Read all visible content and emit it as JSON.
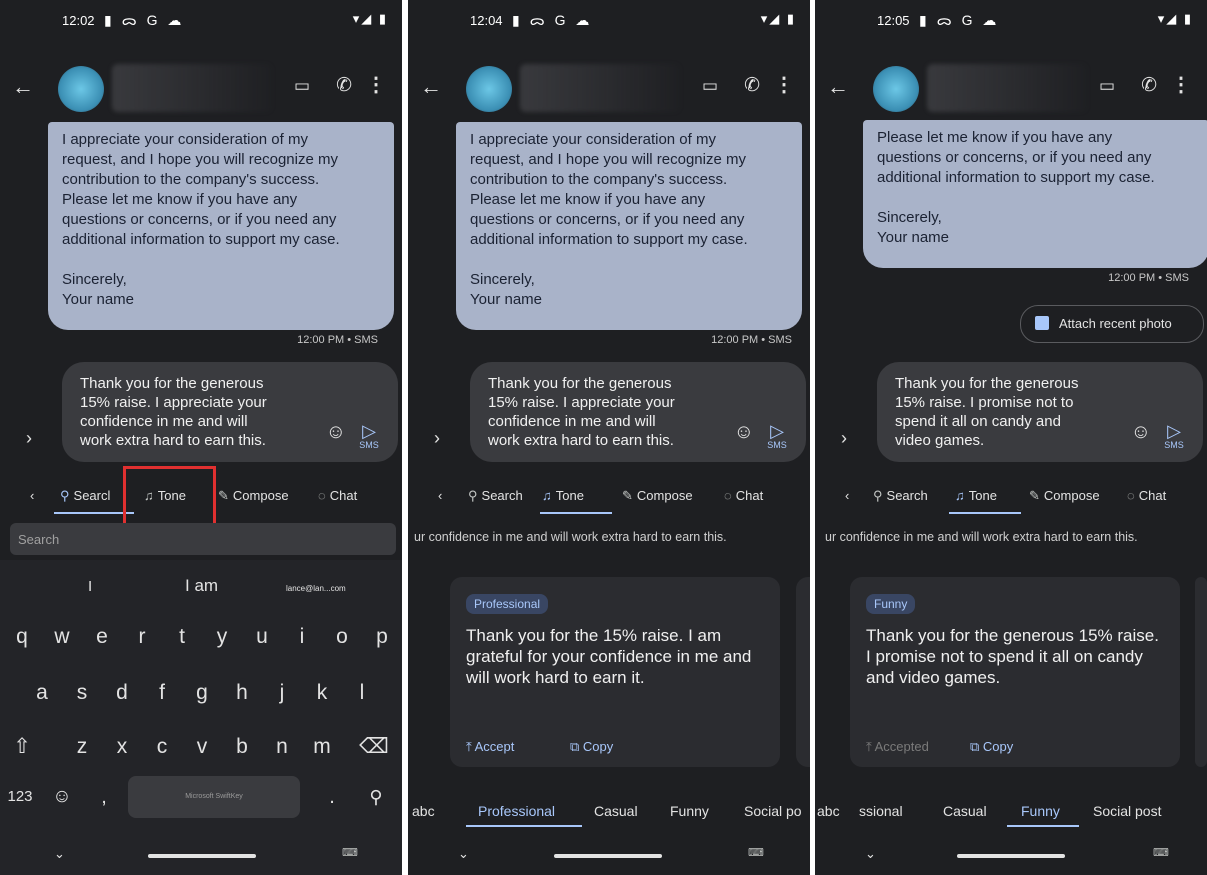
{
  "panels": [
    {
      "time": "12:02",
      "status_icons": "▮ ᯅ G ☁",
      "status_right": "▾◢ ▮",
      "bubble_lines": [
        "I appreciate your consideration of my",
        "request, and I hope you will recognize my",
        "contribution to the company's success.",
        "Please let me know if you have any",
        "questions or concerns, or if you need any",
        "additional information to support my case."
      ],
      "sign_off": [
        "Sincerely,",
        "Your name"
      ],
      "meta": "12:00 PM • SMS",
      "draft_lines": [
        "Thank you for the generous",
        "15% raise. I appreciate your",
        "confidence in me and will",
        "work extra hard to earn this."
      ],
      "send_label": "SMS",
      "toolbar": {
        "search": "Searcl",
        "tone": "Tone",
        "compose": "Compose",
        "chat": "Chat"
      },
      "search_placeholder": "Search",
      "suggestions": [
        "I",
        "I am",
        "lance@lan...com"
      ],
      "rows": [
        [
          "q",
          "w",
          "e",
          "r",
          "t",
          "y",
          "u",
          "i",
          "o",
          "p"
        ],
        [
          "a",
          "s",
          "d",
          "f",
          "g",
          "h",
          "j",
          "k",
          "l"
        ],
        [
          "z",
          "x",
          "c",
          "v",
          "b",
          "n",
          "m"
        ]
      ],
      "key_123": "123",
      "spacebar_label": "Microsoft SwiftKey"
    },
    {
      "time": "12:04",
      "status_icons": "▮ ᯅ G ☁",
      "status_right": "▾◢ ▮",
      "bubble_lines": [
        "I appreciate your consideration of my",
        "request, and I hope you will recognize my",
        "contribution to the company's success.",
        "Please let me know if you have any",
        "questions or concerns, or if you need any",
        "additional information to support my case."
      ],
      "sign_off": [
        "Sincerely,",
        "Your name"
      ],
      "meta": "12:00 PM • SMS",
      "draft_lines": [
        "Thank you for the generous",
        "15% raise. I appreciate your",
        "confidence in me and will",
        "work extra hard to earn this."
      ],
      "send_label": "SMS",
      "toolbar": {
        "search": "Search",
        "tone": "Tone",
        "compose": "Compose",
        "chat": "Chat"
      },
      "preview": "ur confidence in me and will work extra hard to earn this.",
      "card": {
        "chip": "Professional",
        "text": "Thank you for the 15% raise. I am grateful for your confidence in me and will work hard to earn it.",
        "accept": "Accept",
        "copy": "Copy"
      },
      "tones": [
        "abc",
        "Professional",
        "Casual",
        "Funny",
        "Social po"
      ]
    },
    {
      "time": "12:05",
      "status_icons": "▮ ᯅ G ☁",
      "status_right": "▾◢ ▮",
      "bubble_lines": [
        "Please let me know if you have any",
        "questions or concerns, or if you need any",
        "additional information to support my case."
      ],
      "sign_off": [
        "Sincerely,",
        "Your name"
      ],
      "meta": "12:00 PM • SMS",
      "attach": "Attach recent photo",
      "draft_lines": [
        "Thank you for the generous",
        "15% raise. I promise not to",
        "spend it all on candy and",
        "video games."
      ],
      "send_label": "SMS",
      "toolbar": {
        "search": "Search",
        "tone": "Tone",
        "compose": "Compose",
        "chat": "Chat"
      },
      "preview": "ur confidence in me and will work extra hard to earn this.",
      "card": {
        "chip": "Funny",
        "text": "Thank you for the generous 15% raise. I promise not to spend it all on candy and video games.",
        "accept": "Accepted",
        "copy": "Copy"
      },
      "tones": [
        "abc",
        "ssional",
        "Casual",
        "Funny",
        "Social post"
      ]
    }
  ]
}
